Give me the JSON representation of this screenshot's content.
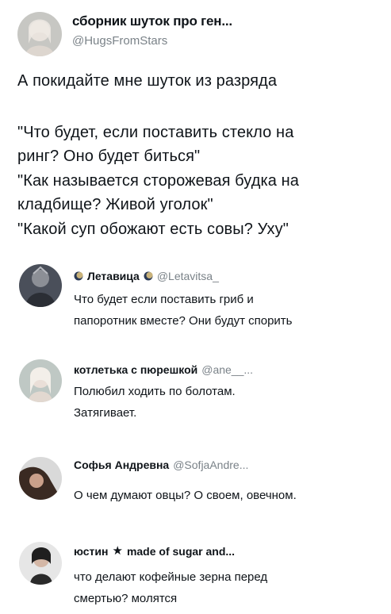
{
  "main_post": {
    "author_name": "сборник шуток про ген...",
    "author_handle": "@HugsFromStars",
    "lines": [
      "А покидайте мне шуток из разряда",
      "\"Что будет, если поставить стекло на",
      "ринг? Оно будет биться\"",
      "\"Как называется сторожевая будка на",
      "кладбище? Живой уголок\"",
      "\"Какой суп обожают есть совы? Уху\""
    ]
  },
  "replies": [
    {
      "author_name": "Летавица",
      "author_handle": "@Letavitsa_",
      "icons": [
        "moon-icon",
        "moon-icon"
      ],
      "lines": [
        "Что будет если поставить гриб и",
        "папоротник вместе? Они будут спорить"
      ]
    },
    {
      "author_name": "котлетька с пюрешкой",
      "author_handle": "@ane__...",
      "lines": [
        "Полюбил ходить по болотам.",
        "Затягивает."
      ]
    },
    {
      "author_name": "Софья Андревна",
      "author_handle": "@SofjaAndre...",
      "lines": [
        "О чем думают овцы? О своем, овечном."
      ]
    },
    {
      "author_name": "юстин",
      "author_extra": "★",
      "author_tail": "made of sugar and...",
      "lines": [
        "что делают кофейные зерна перед",
        "смертью? молятся"
      ]
    }
  ]
}
